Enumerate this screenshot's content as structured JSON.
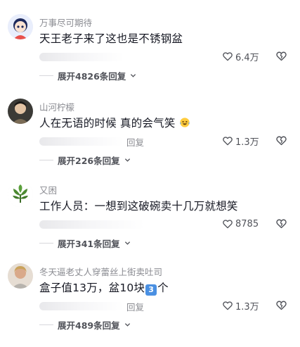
{
  "comments": [
    {
      "username": "万事尽可期待",
      "text": "天王老子来了这也是不锈钢盆",
      "reply": "",
      "likes": "6.4万",
      "expand": "展开4826条回复"
    },
    {
      "username": "山河柠檬",
      "text": "人在无语的时候 真的会气笑",
      "reply": "回复",
      "likes": "1.3万",
      "expand": "展开226条回复"
    },
    {
      "username": "又困",
      "text": "工作人员：一想到这破碗卖十几万就想笑",
      "reply": "",
      "likes": "8785",
      "expand": "展开341条回复"
    },
    {
      "username": "冬天逼老丈人穿蕾丝上街卖吐司",
      "text_a": "盒子值13万，盆10块",
      "text_b": "个",
      "keycap": "3",
      "reply": "回复",
      "likes": "1.3万",
      "expand": "展开489条回复"
    }
  ],
  "icons": {
    "like": "heart-outline-icon",
    "dislike": "broken-heart-icon",
    "expand": "chevron-down-icon",
    "emoji": "laughing-tears-emoji-icon"
  }
}
